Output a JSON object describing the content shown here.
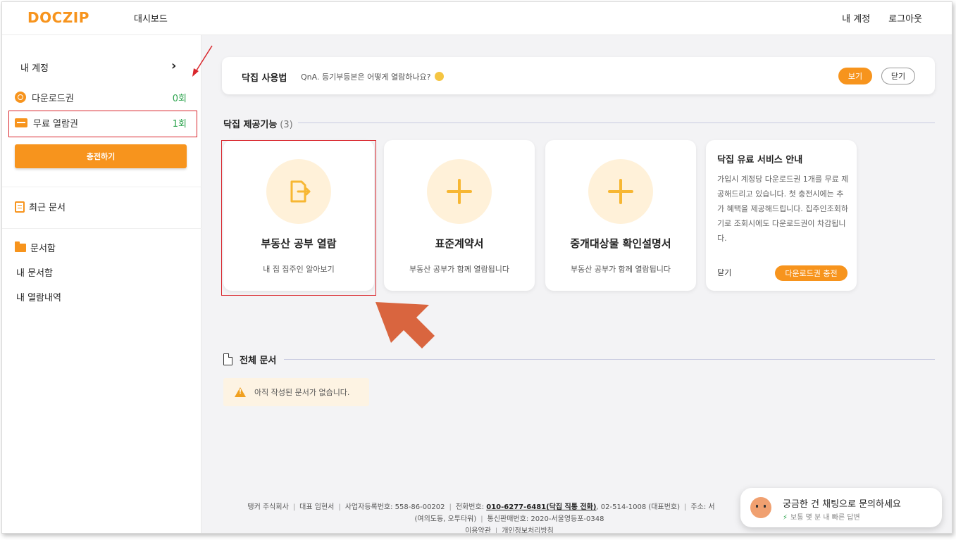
{
  "header": {
    "logo": "DOCZIP",
    "nav_dashboard": "대시보드",
    "my_account": "내 계정",
    "logout": "로그아웃"
  },
  "sidebar": {
    "account_label": "내 계정",
    "download_label": "다운로드권",
    "download_value": "0회",
    "free_label": "무료 열람권",
    "free_value": "1회",
    "charge_button": "충전하기",
    "recent_docs": "최근 문서",
    "doc_box": "문서함",
    "my_doc_box": "내 문서함",
    "my_history": "내 열람내역"
  },
  "usage": {
    "title": "닥집 사용법",
    "qna": "QnA. 등기부등본은 어떻게 열람하나요?",
    "view_button": "보기",
    "close_button": "닫기"
  },
  "features": {
    "title": "닥집 제공기능",
    "count": "(3)",
    "cards": [
      {
        "title": "부동산 공부 열람",
        "subtitle": "내 집 집주인 알아보기"
      },
      {
        "title": "표준계약서",
        "subtitle": "부동산 공부가 함께 열람됩니다"
      },
      {
        "title": "중개대상물 확인설명서",
        "subtitle": "부동산 공부가 함께 열람됩니다"
      }
    ],
    "info": {
      "title": "닥집 유료 서비스 안내",
      "body": "가입시 계정당 다운로드권 1개를 무료 제공해드리고 있습니다. 첫 충전시에는 추가 혜택을 제공해드립니다. 집주인조회하기로 조회시에도 다운로드권이 차감됩니다.",
      "close": "닫기",
      "button": "다운로드권 충전"
    }
  },
  "documents": {
    "title": "전체 문서",
    "empty": "아직 작성된 문서가 없습니다."
  },
  "footer": {
    "company": "탱커 주식회사",
    "ceo": "대표 임현서",
    "biz_no": "사업자등록번호: 558-86-00202",
    "phone_label": "전화번호:",
    "phone_main": "010-6277-6481(닥집 직통 전화)",
    "phone_rep": ", 02-514-1008 (대표번호)",
    "address": "주소: 서",
    "address_2": "(여의도동, 오투타워)",
    "mail_order": "통신판매번호: 2020-서울영등포-0348",
    "terms": "이용약관",
    "privacy": "개인정보처리방침"
  },
  "chat": {
    "title": "궁금한 건 채팅으로 문의하세요",
    "subtitle": "보통 몇 분 내 빠른 답변"
  },
  "colors": {
    "accent": "#f7941d",
    "success": "#2ea44f",
    "highlight": "#d9262c"
  }
}
